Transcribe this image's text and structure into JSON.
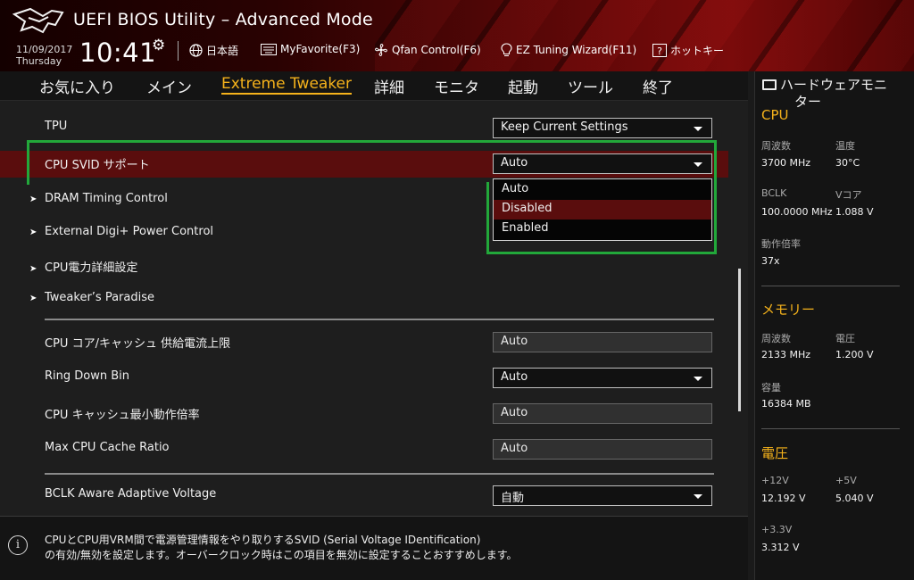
{
  "header": {
    "title": "UEFI BIOS Utility – Advanced Mode",
    "date": "11/09/2017",
    "day": "Thursday",
    "time": "10:41",
    "language": "日本語",
    "myfavorite": "MyFavorite(F3)",
    "qfan": "Qfan Control(F6)",
    "ez_tuning": "EZ Tuning Wizard(F11)",
    "hotkeys": "ホットキー"
  },
  "tabs": [
    "お気に入り",
    "メイン",
    "Extreme Tweaker",
    "詳細",
    "モニタ",
    "起動",
    "ツール",
    "終了"
  ],
  "active_tab": "Extreme Tweaker",
  "settings": {
    "tpu": {
      "label": "TPU",
      "value": "Keep Current Settings"
    },
    "svid": {
      "label": "CPU SVID サポート",
      "value": "Auto"
    },
    "dram_timing": "DRAM Timing Control",
    "digi_power": "External Digi+ Power Control",
    "cpu_power": "CPU電力詳細設定",
    "tweakers": "Tweaker’s Paradise",
    "cache_current": {
      "label": "CPU コア/キャッシュ 供給電流上限",
      "value": "Auto"
    },
    "ring_down": {
      "label": "Ring Down Bin",
      "value": "Auto"
    },
    "cache_min": {
      "label": "CPU キャッシュ最小動作倍率",
      "value": "Auto"
    },
    "cache_max": {
      "label": "Max CPU Cache Ratio",
      "value": "Auto"
    },
    "bclk_aware": {
      "label": "BCLK Aware Adaptive Voltage",
      "value": "自動"
    }
  },
  "dropdown": {
    "options": [
      "Auto",
      "Disabled",
      "Enabled"
    ],
    "highlighted": "Disabled"
  },
  "help": {
    "line1": "CPUとCPU用VRM間で電源管理情報をやり取りするSVID (Serial Voltage IDentification)",
    "line2": "の有効/無効を設定します。オーバークロック時はこの項目を無効に設定することおすすめします。"
  },
  "hw_monitor": {
    "title_line1": "ハードウェアモニ",
    "title_line2": "ター",
    "cpu": {
      "heading": "CPU",
      "freq_label": "周波数",
      "freq": "3700 MHz",
      "temp_label": "温度",
      "temp": "30°C",
      "bclk_label": "BCLK",
      "bclk": "100.0000 MHz",
      "vcore_label": "Vコア",
      "vcore": "1.088 V",
      "ratio_label": "動作倍率",
      "ratio": "37x"
    },
    "memory": {
      "heading": "メモリー",
      "freq_label": "周波数",
      "freq": "2133 MHz",
      "volt_label": "電圧",
      "volt": "1.200 V",
      "cap_label": "容量",
      "cap": "16384 MB"
    },
    "voltage": {
      "heading": "電圧",
      "v12_label": "+12V",
      "v12": "12.192 V",
      "v5_label": "+5V",
      "v5": "5.040 V",
      "v33_label": "+3.3V",
      "v33": "3.312 V"
    }
  },
  "colors": {
    "accent": "#f5b21b",
    "selection": "#5a0d0d",
    "highlight_box": "#22a83a"
  }
}
